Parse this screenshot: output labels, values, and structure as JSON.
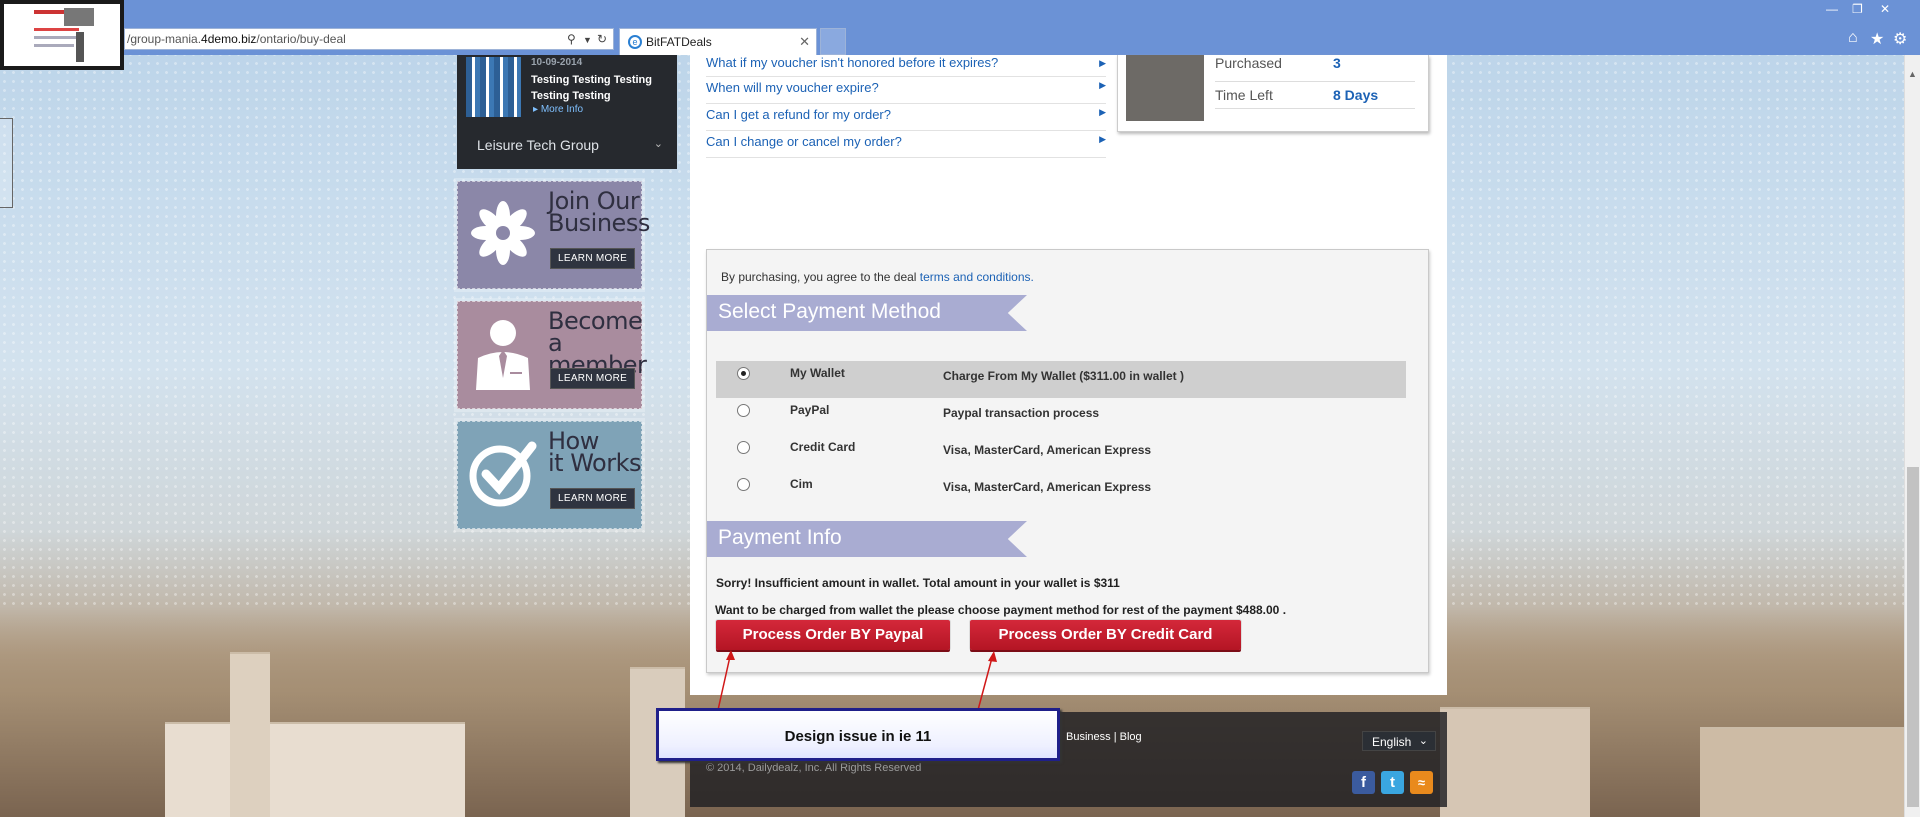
{
  "browser": {
    "url_prefix": "/group-mania.",
    "url_domain": "4demo.biz",
    "url_suffix": "/ontario/buy-deal",
    "tab_title": "BitFATDeals"
  },
  "sidebar": {
    "deal": {
      "date": "10-09-2014",
      "title": "Testing Testing Testing Testing Testing",
      "more_info": "More Info"
    },
    "group_title": "Leisure Tech Group",
    "promos": [
      {
        "title_line1": "Join Our",
        "title_line2": "Business",
        "button": "LEARN MORE",
        "color": "#8b87a8"
      },
      {
        "title_line1": "Become a",
        "title_line2": "member",
        "button": "LEARN MORE",
        "color": "#a98c9e"
      },
      {
        "title_line1": "How",
        "title_line2": "it Works",
        "button": "LEARN MORE",
        "color": "#7fa3b7"
      }
    ]
  },
  "faq": [
    "What if my voucher isn't honored before it expires?",
    "When will my voucher expire?",
    "Can I get a refund for my order?",
    "Can I change or cancel my order?"
  ],
  "product": {
    "purchased_label": "Purchased",
    "purchased_value": "3",
    "time_left_label": "Time Left",
    "time_left_value": "8 Days"
  },
  "payment": {
    "agree_text": "By purchasing, you agree to the deal ",
    "agree_link": "terms and conditions.",
    "select_heading": "Select Payment Method",
    "methods": [
      {
        "name": "My Wallet",
        "desc": "Charge From My Wallet ($311.00 in wallet )",
        "selected": true
      },
      {
        "name": "PayPal",
        "desc": "Paypal transaction process",
        "selected": false
      },
      {
        "name": "Credit Card",
        "desc": "Visa, MasterCard, American Express",
        "selected": false
      },
      {
        "name": "Cim",
        "desc": "Visa, MasterCard, American Express",
        "selected": false
      }
    ],
    "info_heading": "Payment Info",
    "message1": "Sorry! Insufficient amount in wallet. Total amount in your wallet is $311",
    "message2": "Want to be charged from wallet the please choose payment method for rest of the payment $488.00 .",
    "btn_paypal": "Process Order BY Paypal",
    "btn_credit": "Process Order BY Credit Card"
  },
  "annotation": {
    "note": "Design issue in ie 11"
  },
  "footer": {
    "link_business": "Business",
    "separator": "|",
    "link_blog": "Blog",
    "copyright": "© 2014, Dailydealz, Inc. All Rights Reserved",
    "language": "English"
  },
  "colors": {
    "accent_red": "#c41e2e",
    "link_blue": "#1c62b5",
    "ribbon": "#a9acd2",
    "annotation_border": "#1f1f8a"
  }
}
